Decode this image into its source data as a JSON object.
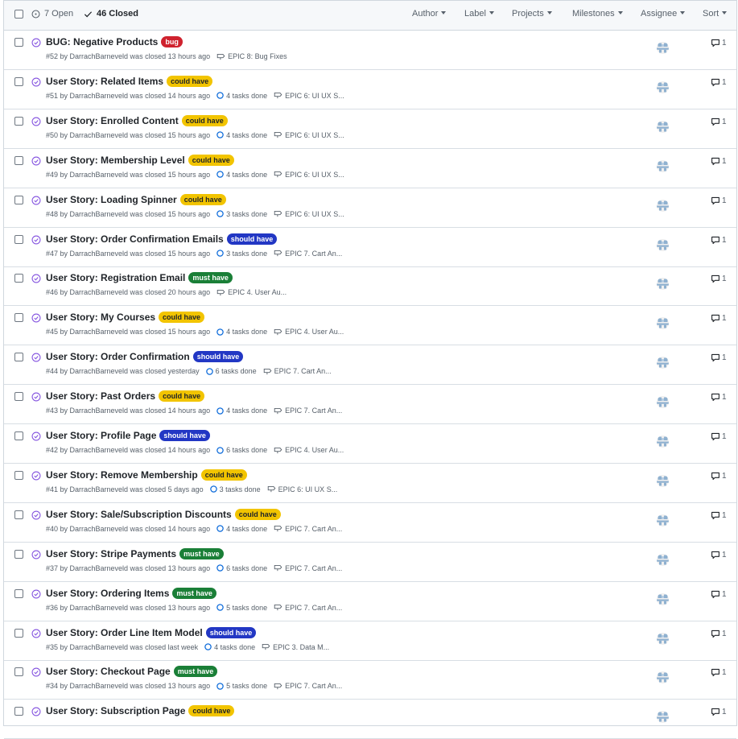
{
  "header": {
    "open_count": "7 Open",
    "closed_count": "46 Closed",
    "filters": [
      "Author",
      "Label",
      "Projects",
      "Milestones",
      "Assignee",
      "Sort"
    ]
  },
  "colors": {
    "closed_icon": "#8250df",
    "bug": "#cf222e",
    "could_have": "#f2c400",
    "should_have": "#2237c4",
    "must_have": "#1a7f37"
  },
  "issues": [
    {
      "title": "BUG: Negative Products",
      "label": "bug",
      "label_kind": "bug",
      "meta": "#52 by DarrachBarneveld was closed 13 hours ago",
      "tasks": "",
      "epic": "EPIC 8: Bug Fixes",
      "comments": "1"
    },
    {
      "title": "User Story: Related Items",
      "label": "could have",
      "label_kind": "could_have",
      "meta": "#51 by DarrachBarneveld was closed 14 hours ago",
      "tasks": "4 tasks done",
      "epic": "EPIC 6: UI UX S...",
      "comments": "1"
    },
    {
      "title": "User Story: Enrolled Content",
      "label": "could have",
      "label_kind": "could_have",
      "meta": "#50 by DarrachBarneveld was closed 15 hours ago",
      "tasks": "4 tasks done",
      "epic": "EPIC 6: UI UX S...",
      "comments": "1"
    },
    {
      "title": "User Story: Membership Level",
      "label": "could have",
      "label_kind": "could_have",
      "meta": "#49 by DarrachBarneveld was closed 15 hours ago",
      "tasks": "4 tasks done",
      "epic": "EPIC 6: UI UX S...",
      "comments": "1"
    },
    {
      "title": "User Story: Loading Spinner",
      "label": "could have",
      "label_kind": "could_have",
      "meta": "#48 by DarrachBarneveld was closed 15 hours ago",
      "tasks": "3 tasks done",
      "epic": "EPIC 6: UI UX S...",
      "comments": "1"
    },
    {
      "title": "User Story: Order Confirmation Emails",
      "label": "should have",
      "label_kind": "should_have",
      "meta": "#47 by DarrachBarneveld was closed 15 hours ago",
      "tasks": "3 tasks done",
      "epic": "EPIC 7. Cart An...",
      "comments": "1"
    },
    {
      "title": "User Story: Registration Email",
      "label": "must have",
      "label_kind": "must_have",
      "meta": "#46 by DarrachBarneveld was closed 20 hours ago",
      "tasks": "",
      "epic": "EPIC 4. User Au...",
      "comments": "1"
    },
    {
      "title": "User Story: My Courses",
      "label": "could have",
      "label_kind": "could_have",
      "meta": "#45 by DarrachBarneveld was closed 15 hours ago",
      "tasks": "4 tasks done",
      "epic": "EPIC 4. User Au...",
      "comments": "1"
    },
    {
      "title": "User Story: Order Confirmation",
      "label": "should have",
      "label_kind": "should_have",
      "meta": "#44 by DarrachBarneveld was closed yesterday",
      "tasks": "6 tasks done",
      "epic": "EPIC 7. Cart An...",
      "comments": "1"
    },
    {
      "title": "User Story: Past Orders",
      "label": "could have",
      "label_kind": "could_have",
      "meta": "#43 by DarrachBarneveld was closed 14 hours ago",
      "tasks": "4 tasks done",
      "epic": "EPIC 7. Cart An...",
      "comments": "1"
    },
    {
      "title": "User Story: Profile Page",
      "label": "should have",
      "label_kind": "should_have",
      "meta": "#42 by DarrachBarneveld was closed 14 hours ago",
      "tasks": "6 tasks done",
      "epic": "EPIC 4. User Au...",
      "comments": "1"
    },
    {
      "title": "User Story: Remove Membership",
      "label": "could have",
      "label_kind": "could_have",
      "meta": "#41 by DarrachBarneveld was closed 5 days ago",
      "tasks": "3 tasks done",
      "epic": "EPIC 6: UI UX S...",
      "comments": "1"
    },
    {
      "title": "User Story: Sale/Subscription Discounts",
      "label": "could have",
      "label_kind": "could_have",
      "meta": "#40 by DarrachBarneveld was closed 14 hours ago",
      "tasks": "4 tasks done",
      "epic": "EPIC 7. Cart An...",
      "comments": "1"
    },
    {
      "title": "User Story: Stripe Payments",
      "label": "must have",
      "label_kind": "must_have",
      "meta": "#37 by DarrachBarneveld was closed 13 hours ago",
      "tasks": "6 tasks done",
      "epic": "EPIC 7. Cart An...",
      "comments": "1"
    },
    {
      "title": "User Story: Ordering Items",
      "label": "must have",
      "label_kind": "must_have",
      "meta": "#36 by DarrachBarneveld was closed 13 hours ago",
      "tasks": "5 tasks done",
      "epic": "EPIC 7. Cart An...",
      "comments": "1"
    },
    {
      "title": "User Story: Order Line Item Model",
      "label": "should have",
      "label_kind": "should_have",
      "meta": "#35 by DarrachBarneveld was closed last week",
      "tasks": "4 tasks done",
      "epic": "EPIC 3. Data M...",
      "comments": "1"
    },
    {
      "title": "User Story: Checkout Page",
      "label": "must have",
      "label_kind": "must_have",
      "meta": "#34 by DarrachBarneveld was closed 13 hours ago",
      "tasks": "5 tasks done",
      "epic": "EPIC 7. Cart An...",
      "comments": "1"
    },
    {
      "title": "User Story: Subscription Page",
      "label": "could have",
      "label_kind": "could_have",
      "meta": "",
      "tasks": "",
      "epic": "",
      "comments": "1"
    }
  ]
}
